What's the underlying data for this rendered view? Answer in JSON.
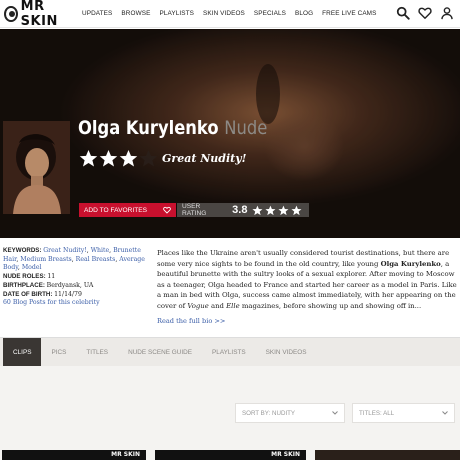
{
  "brand": {
    "logo_text": "MR SKIN"
  },
  "nav": {
    "items": [
      "UPDATES",
      "BROWSE",
      "PLAYLISTS",
      "SKIN VIDEOS",
      "SPECIALS",
      "BLOG",
      "FREE LIVE CAMS"
    ]
  },
  "header_icons": [
    "search-icon",
    "heart-icon",
    "user-icon"
  ],
  "celebrity": {
    "name": "Olga Kurylenko",
    "nude_suffix": "Nude",
    "star_rating": 3,
    "star_max": 4,
    "rating_text": "Great Nudity!"
  },
  "actions": {
    "add_favorites": "ADD TO FAVORITES",
    "user_rating_label": "USER RATING",
    "user_rating_value": "3.8",
    "user_rating_stars": 4
  },
  "facts": {
    "keywords_label": "KEYWORDS:",
    "keywords": [
      "Great Nudity!",
      "White",
      "Brunette Hair",
      "Medium Breasts",
      "Real Breasts",
      "Average Body",
      "Model"
    ],
    "nude_roles_label": "NUDE ROLES:",
    "nude_roles": "11",
    "birthplace_label": "BIRTHPLACE:",
    "birthplace": "Berdyansk, UA",
    "dob_label": "DATE OF BIRTH:",
    "dob": "11/14/79",
    "blog_posts": "60 Blog Posts for this celebrity"
  },
  "bio": {
    "p1": "Places like the Ukraine aren't usually considered tourist destinations, but there are some very nice sights to be found in the old country, like young ",
    "name_bold": "Olga Kurylenko",
    "p2": ", a beautiful brunette with the sultry looks of a sexual explorer. After moving to Moscow as a teenager, Olga headed to France and started her career as a model in Paris. Like a man in bed with Olga, success came almost immediately, with her appearing on the cover of ",
    "mag1": "Vogue",
    "and": " and ",
    "mag2": "Elle",
    "p3": " magazines, before showing up and showing off in...",
    "read_more": "Read the full bio >>"
  },
  "tabs": [
    "CLIPS",
    "PICS",
    "TITLES",
    "NUDE SCENE GUIDE",
    "PLAYLISTS",
    "SKIN VIDEOS"
  ],
  "active_tab": "CLIPS",
  "filters": {
    "sort": "SORT BY: NUDITY",
    "titles": "TITLES: ALL"
  },
  "clips": [
    {
      "badge": "MR SKIN"
    },
    {
      "badge": "MR SKIN"
    },
    {
      "badge": ""
    }
  ],
  "colors": {
    "accent_red": "#c8102e",
    "link_blue": "#3b5ea8",
    "star_white": "#ffffff",
    "tab_active": "#3a3633"
  }
}
